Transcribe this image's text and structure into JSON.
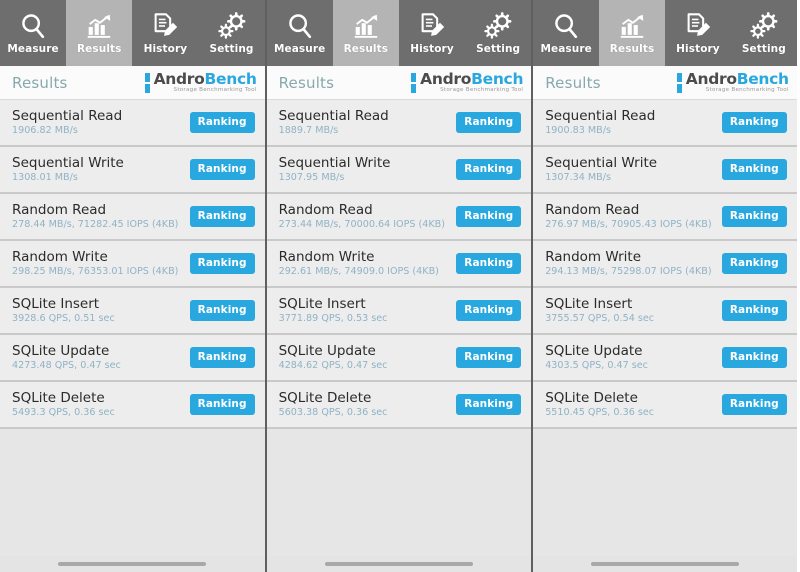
{
  "colors": {
    "accent": "#29a8e0",
    "tab_inactive_bg": "#6e6e6e",
    "tab_active_bg": "#b4b4b4",
    "row_bg": "#ededed",
    "row_divider": "#c9c9c9",
    "header_title": "#86a9ad",
    "metric_value": "#8fb3c6",
    "page_bg": "#e4e4e4"
  },
  "tabs": [
    {
      "label": "Measure",
      "icon": "magnifier-icon",
      "active": false
    },
    {
      "label": "Results",
      "icon": "bar-chart-icon",
      "active": true
    },
    {
      "label": "History",
      "icon": "document-pencil-icon",
      "active": false
    },
    {
      "label": "Setting",
      "icon": "gears-icon",
      "active": false
    }
  ],
  "header": {
    "title": "Results",
    "logo_primary": "Andro",
    "logo_secondary": "Bench",
    "logo_tagline": "Storage Benchmarking Tool",
    "logo_icon": "androbench-battery-icon"
  },
  "row_button_label": "Ranking",
  "panes": [
    {
      "rows": [
        {
          "name": "Sequential Read",
          "value": "1906.82 MB/s"
        },
        {
          "name": "Sequential Write",
          "value": "1308.01 MB/s"
        },
        {
          "name": "Random Read",
          "value": "278.44 MB/s, 71282.45 IOPS (4KB)"
        },
        {
          "name": "Random Write",
          "value": "298.25 MB/s, 76353.01 IOPS (4KB)"
        },
        {
          "name": "SQLite Insert",
          "value": "3928.6 QPS, 0.51 sec"
        },
        {
          "name": "SQLite Update",
          "value": "4273.48 QPS, 0.47 sec"
        },
        {
          "name": "SQLite Delete",
          "value": "5493.3 QPS, 0.36 sec"
        }
      ]
    },
    {
      "rows": [
        {
          "name": "Sequential Read",
          "value": "1889.7 MB/s"
        },
        {
          "name": "Sequential Write",
          "value": "1307.95 MB/s"
        },
        {
          "name": "Random Read",
          "value": "273.44 MB/s, 70000.64 IOPS (4KB)"
        },
        {
          "name": "Random Write",
          "value": "292.61 MB/s, 74909.0 IOPS (4KB)"
        },
        {
          "name": "SQLite Insert",
          "value": "3771.89 QPS, 0.53 sec"
        },
        {
          "name": "SQLite Update",
          "value": "4284.62 QPS, 0.47 sec"
        },
        {
          "name": "SQLite Delete",
          "value": "5603.38 QPS, 0.36 sec"
        }
      ]
    },
    {
      "rows": [
        {
          "name": "Sequential Read",
          "value": "1900.83 MB/s"
        },
        {
          "name": "Sequential Write",
          "value": "1307.34 MB/s"
        },
        {
          "name": "Random Read",
          "value": "276.97 MB/s, 70905.43 IOPS (4KB)"
        },
        {
          "name": "Random Write",
          "value": "294.13 MB/s, 75298.07 IOPS (4KB)"
        },
        {
          "name": "SQLite Insert",
          "value": "3755.57 QPS, 0.54 sec"
        },
        {
          "name": "SQLite Update",
          "value": "4303.5 QPS, 0.47 sec"
        },
        {
          "name": "SQLite Delete",
          "value": "5510.45 QPS, 0.36 sec"
        }
      ]
    }
  ]
}
